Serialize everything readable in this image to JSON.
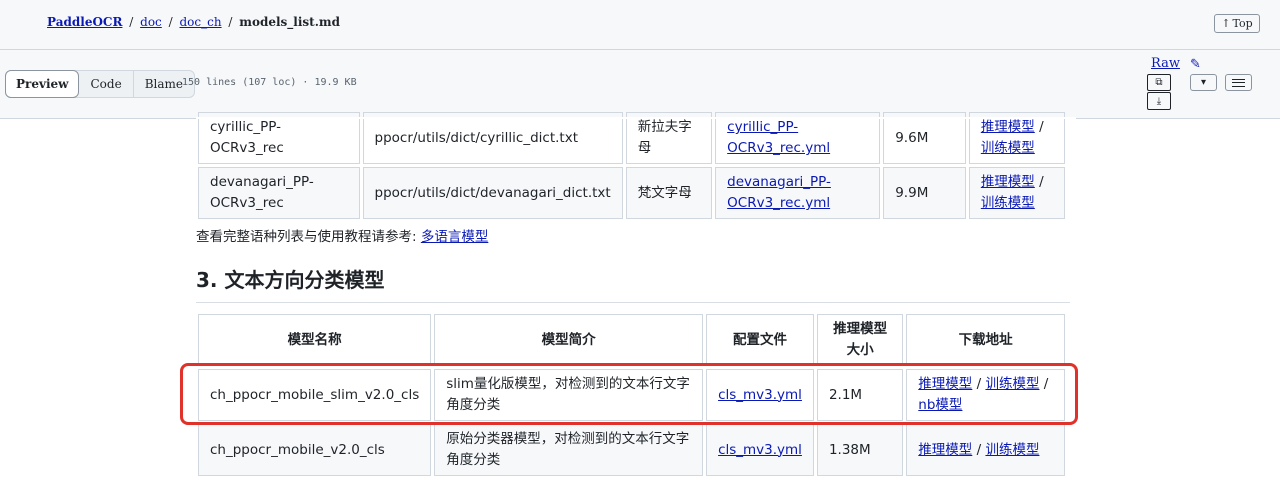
{
  "breadcrumb": {
    "repo": "PaddleOCR",
    "parts": [
      "doc",
      "doc_ch"
    ],
    "separator": "/",
    "file": "models_list.md"
  },
  "top_button": {
    "arrow": "↑",
    "label": "Top"
  },
  "toolbar": {
    "tabs": [
      "Preview",
      "Code",
      "Blame"
    ],
    "file_info": "150 lines (107 loc) · 19.9 KB",
    "raw_label": "Raw",
    "pencil_glyph": "✎",
    "copy_glyph": "⧉",
    "download_glyph": "⤓",
    "dropdown_glyph": "▾"
  },
  "table_top": {
    "rows": [
      [
        "cyrillic_PP-OCRv3_rec",
        "ppocr/utils/dict/cyrillic_dict.txt",
        "新拉夫字母",
        "cyrillic_PP-OCRv3_rec.yml",
        "9.6M",
        "推理模型",
        "训练模型"
      ],
      [
        "devanagari_PP-OCRv3_rec",
        "ppocr/utils/dict/devanagari_dict.txt",
        "梵文字母",
        "devanagari_PP-OCRv3_rec.yml",
        "9.9M",
        "推理模型",
        "训练模型"
      ]
    ]
  },
  "note": {
    "text": "查看完整语种列表与使用教程请参考: ",
    "link": "多语言模型"
  },
  "section_heading": "3. 文本方向分类模型",
  "cls_table": {
    "headers": [
      "模型名称",
      "模型简介",
      "配置文件",
      "推理模型大小",
      "下载地址"
    ],
    "rows": [
      {
        "name": "ch_ppocr_mobile_slim_v2.0_cls",
        "desc": "slim量化版模型，对检测到的文本行文字角度分类",
        "config": "cls_mv3.yml",
        "size": "2.1M",
        "links": [
          "推理模型",
          "训练模型",
          "nb模型"
        ]
      },
      {
        "name": "ch_ppocr_mobile_v2.0_cls",
        "desc": "原始分类器模型，对检测到的文本行文字角度分类",
        "config": "cls_mv3.yml",
        "size": "1.38M",
        "links": [
          "推理模型",
          "训练模型"
        ]
      }
    ],
    "link_sep": "/"
  },
  "colors": {
    "link": "#0a19b4",
    "highlight": "#e0322a",
    "border": "#d0d7de"
  }
}
